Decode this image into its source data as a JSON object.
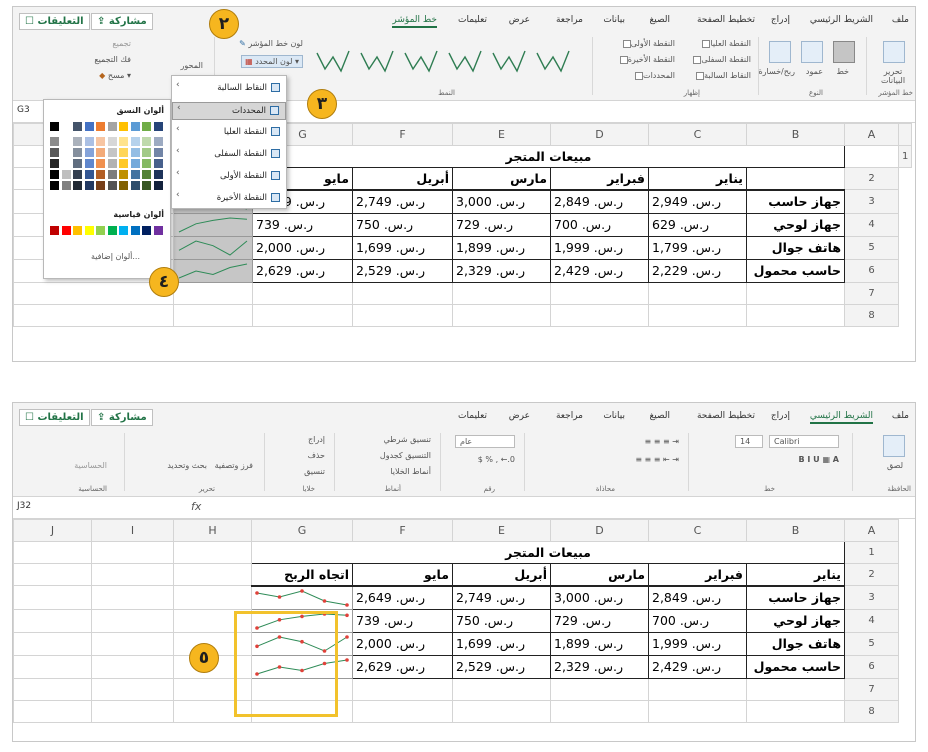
{
  "top": {
    "tabs": [
      "ملف",
      "الشريط الرئيسي",
      "إدراج",
      "تخطيط الصفحة",
      "الصيغ",
      "بيانات",
      "مراجعة",
      "عرض",
      "تعليمات",
      "خط المؤشر"
    ],
    "share": "مشاركة",
    "comments": "التعليقات",
    "ribbon": {
      "edit_data": "تحرير البيانات",
      "line": "خط",
      "column": "عمود",
      "winloss": "ربح/خسارة",
      "high": "النقطة العليا",
      "low": "النقطة السفلى",
      "negative": "النقاط السالبة",
      "first": "النقطة الأولى",
      "last": "النقطة الأخيرة",
      "markers": "المحددات",
      "group_sparkline": "خط المؤشر",
      "group_type": "النوع",
      "group_show": "إظهار",
      "group_style": "النمط",
      "sparkline_color": "لون خط المؤشر",
      "marker_color": "لون المحدد",
      "axis": "المحور",
      "group": "تجميع",
      "ungroup": "فك التجميع",
      "clear": "مسح"
    },
    "menu": {
      "items": [
        "النقاط السالبة",
        "المحددات",
        "النقطة العليا",
        "النقطة السفلى",
        "النقطة الأولى",
        "النقطة الأخيرة"
      ]
    },
    "palette": {
      "theme_title": "ألوان النسق",
      "standard_title": "ألوان قياسية",
      "more": "ألوان إضافية...",
      "theme_row": [
        "#000000",
        "#ffffff",
        "#44546a",
        "#4472c4",
        "#ed7d31",
        "#a5a5a5",
        "#ffc000",
        "#5b9bd5",
        "#70ad47",
        "#264478"
      ],
      "standard_row": [
        "#c00000",
        "#ff0000",
        "#ffc000",
        "#ffff00",
        "#92d050",
        "#00b050",
        "#00b0f0",
        "#0070c0",
        "#002060",
        "#7030a0"
      ]
    },
    "namebox": "G3",
    "badges": [
      "٢",
      "٣",
      "٤"
    ]
  },
  "bottom": {
    "tabs": [
      "ملف",
      "الشريط الرئيسي",
      "إدراج",
      "تخطيط الصفحة",
      "الصيغ",
      "بيانات",
      "مراجعة",
      "عرض",
      "تعليمات"
    ],
    "share": "مشاركة",
    "comments": "التعليقات",
    "ribbon": {
      "paste": "لصق",
      "clipboard": "الحافظة",
      "font_name": "Calibri",
      "font_size": "14",
      "font": "خط",
      "alignment": "محاذاة",
      "number_format": "عام",
      "number": "رقم",
      "cond_format": "تنسيق شرطي",
      "format_table": "التنسيق كجدول",
      "cell_styles": "أنماط الخلايا",
      "styles": "أنماط",
      "insert": "إدراج",
      "delete": "حذف",
      "format": "تنسيق",
      "cells": "خلايا",
      "sort_filter": "فرز وتصفية",
      "find_select": "بحث وتحديد",
      "editing": "تحرير",
      "sensitivity": "الحساسية"
    },
    "namebox": "J32",
    "badges": [
      "٥"
    ]
  },
  "sheet": {
    "columns": [
      "A",
      "B",
      "C",
      "D",
      "E",
      "F",
      "G",
      "H",
      "I",
      "J"
    ],
    "rows": [
      "1",
      "2",
      "3",
      "4",
      "5",
      "6",
      "7",
      "8"
    ],
    "title": "مبيعات المتجر",
    "months": [
      "يناير",
      "فبراير",
      "مارس",
      "أبريل",
      "مايو"
    ],
    "trend_header": "اتجاه الربح",
    "products": [
      {
        "name": "جهاز حاسب",
        "values": [
          "ر.س. 2,949",
          "ر.س. 2,849",
          "ر.س. 3,000",
          "ر.س. 2,749",
          "ر.س. 2,649"
        ]
      },
      {
        "name": "جهاز لوحي",
        "values": [
          "ر.س. 629",
          "ر.س. 700",
          "ر.س. 729",
          "ر.س. 750",
          "ر.س. 739"
        ]
      },
      {
        "name": "هاتف جوال",
        "values": [
          "ر.س. 1,799",
          "ر.س. 1,999",
          "ر.س. 1,899",
          "ر.س. 1,699",
          "ر.س. 2,000"
        ]
      },
      {
        "name": "حاسب محمول",
        "values": [
          "ر.س. 2,229",
          "ر.س. 2,429",
          "ر.س. 2,329",
          "ر.س. 2,529",
          "ر.س. 2,629"
        ]
      }
    ],
    "trend_values": [
      [
        2949,
        2849,
        3000,
        2749,
        2649
      ],
      [
        629,
        700,
        729,
        750,
        739
      ],
      [
        1799,
        1999,
        1899,
        1699,
        2000
      ],
      [
        2229,
        2429,
        2329,
        2529,
        2629
      ]
    ],
    "colors": {
      "sparkline": "#2e8b57",
      "marker": "#e0413a"
    }
  }
}
